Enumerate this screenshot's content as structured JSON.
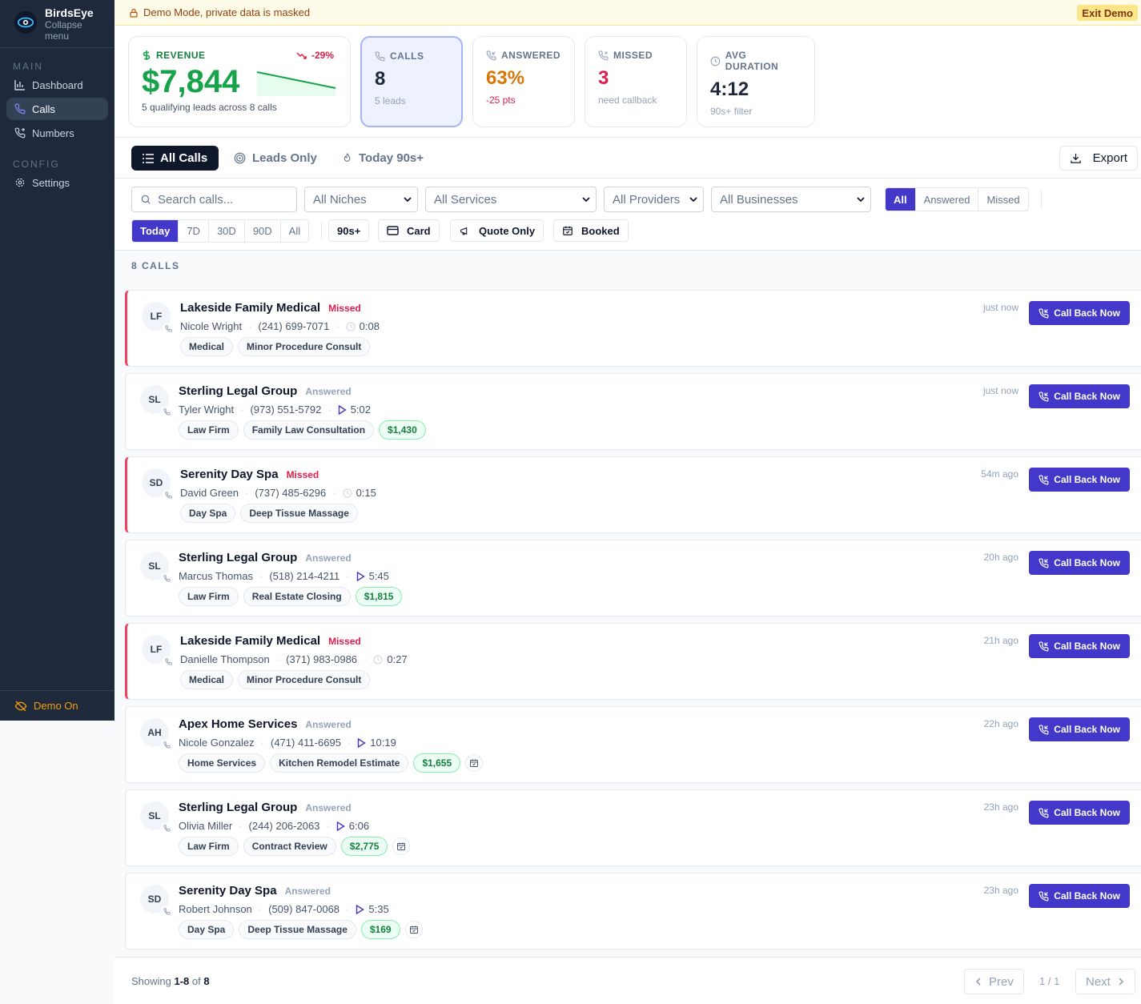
{
  "brand": {
    "name": "BirdsEye",
    "collapse": "Collapse menu"
  },
  "sidebar": {
    "main_label": "MAIN",
    "config_label": "CONFIG",
    "items": [
      {
        "label": "Dashboard",
        "icon": "bar-chart-icon"
      },
      {
        "label": "Calls",
        "icon": "phone-icon",
        "active": true
      },
      {
        "label": "Numbers",
        "icon": "phone-forward-icon"
      },
      {
        "label": "Settings",
        "icon": "gear-icon"
      }
    ],
    "demo": "Demo On"
  },
  "banner": {
    "text": "Demo Mode, private data is masked",
    "exit": "Exit Demo"
  },
  "stats": {
    "revenue": {
      "label": "REVENUE",
      "value": "$7,844",
      "trend": "-29%",
      "sub": "5 qualifying leads across 8 calls"
    },
    "calls": {
      "label": "CALLS",
      "value": "8",
      "sub": "5 leads"
    },
    "answered": {
      "label": "ANSWERED",
      "value": "63%",
      "sub": "-25 pts"
    },
    "missed": {
      "label": "MISSED",
      "value": "3",
      "sub": "need callback"
    },
    "avg": {
      "label": "AVG DURATION",
      "value": "4:12",
      "sub": "90s+ filter"
    }
  },
  "tabs": {
    "all": "All Calls",
    "leads": "Leads Only",
    "today": "Today 90s+",
    "export": "Export"
  },
  "filters": {
    "search_placeholder": "Search calls...",
    "niches": "All Niches",
    "services": "All Services",
    "providers": "All Providers",
    "businesses": "All Businesses",
    "status": [
      "All",
      "Answered",
      "Missed"
    ],
    "ranges": [
      "Today",
      "7D",
      "30D",
      "90D",
      "All"
    ],
    "min90": "90s+",
    "card": "Card",
    "quote": "Quote Only",
    "booked": "Booked"
  },
  "count_label": "8 CALLS",
  "callback_label": "Call Back Now",
  "calls": [
    {
      "initials": "LF",
      "business": "Lakeside Family Medical",
      "status": "Missed",
      "caller": "Nicole Wright",
      "phone": "(241) 699-7071",
      "duration": "0:08",
      "time": "just now",
      "tags": [
        "Medical",
        "Minor Procedure Consult"
      ],
      "value": "",
      "booked": false
    },
    {
      "initials": "SL",
      "business": "Sterling Legal Group",
      "status": "Answered",
      "caller": "Tyler Wright",
      "phone": "(973) 551-5792",
      "duration": "5:02",
      "time": "just now",
      "tags": [
        "Law Firm",
        "Family Law Consultation"
      ],
      "value": "$1,430",
      "booked": false
    },
    {
      "initials": "SD",
      "business": "Serenity Day Spa",
      "status": "Missed",
      "caller": "David Green",
      "phone": "(737) 485-6296",
      "duration": "0:15",
      "time": "54m ago",
      "tags": [
        "Day Spa",
        "Deep Tissue Massage"
      ],
      "value": "",
      "booked": false
    },
    {
      "initials": "SL",
      "business": "Sterling Legal Group",
      "status": "Answered",
      "caller": "Marcus Thomas",
      "phone": "(518) 214-4211",
      "duration": "5:45",
      "time": "20h ago",
      "tags": [
        "Law Firm",
        "Real Estate Closing"
      ],
      "value": "$1,815",
      "booked": false
    },
    {
      "initials": "LF",
      "business": "Lakeside Family Medical",
      "status": "Missed",
      "caller": "Danielle Thompson",
      "phone": "(371) 983-0986",
      "duration": "0:27",
      "time": "21h ago",
      "tags": [
        "Medical",
        "Minor Procedure Consult"
      ],
      "value": "",
      "booked": false
    },
    {
      "initials": "AH",
      "business": "Apex Home Services",
      "status": "Answered",
      "caller": "Nicole Gonzalez",
      "phone": "(471) 411-6695",
      "duration": "10:19",
      "time": "22h ago",
      "tags": [
        "Home Services",
        "Kitchen Remodel Estimate"
      ],
      "value": "$1,655",
      "booked": true
    },
    {
      "initials": "SL",
      "business": "Sterling Legal Group",
      "status": "Answered",
      "caller": "Olivia Miller",
      "phone": "(244) 206-2063",
      "duration": "6:06",
      "time": "23h ago",
      "tags": [
        "Law Firm",
        "Contract Review"
      ],
      "value": "$2,775",
      "booked": true
    },
    {
      "initials": "SD",
      "business": "Serenity Day Spa",
      "status": "Answered",
      "caller": "Robert Johnson",
      "phone": "(509) 847-0068",
      "duration": "5:35",
      "time": "23h ago",
      "tags": [
        "Day Spa",
        "Deep Tissue Massage"
      ],
      "value": "$169",
      "booked": true
    }
  ],
  "footer": {
    "showing": "Showing",
    "range": "1-8",
    "of": "of",
    "total": "8",
    "prev": "Prev",
    "page": "1 / 1",
    "next": "Next"
  },
  "colors": {
    "accent": "#4338ca",
    "missed": "#e11d48",
    "money": "#16a34a"
  }
}
